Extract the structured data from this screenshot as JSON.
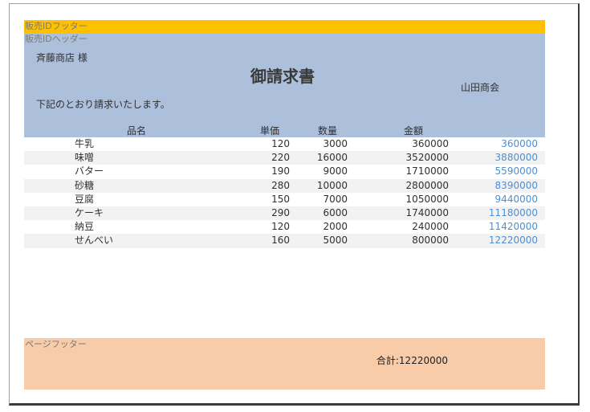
{
  "bands": {
    "footer_id_label": "販売IDフッター",
    "header_id_label": "販売IDヘッダー",
    "page_footer_label": "ページフッター"
  },
  "header": {
    "customer": "斉藤商店 様",
    "title": "御請求書",
    "company": "山田商会",
    "message": "下記のとおり請求いたします。"
  },
  "columns": {
    "name": "品名",
    "price": "単価",
    "quantity": "数量",
    "amount": "金額"
  },
  "rows": [
    {
      "name": "牛乳",
      "price": "120",
      "quantity": "3000",
      "amount": "360000",
      "running": "360000"
    },
    {
      "name": "味噌",
      "price": "220",
      "quantity": "16000",
      "amount": "3520000",
      "running": "3880000"
    },
    {
      "name": "バター",
      "price": "190",
      "quantity": "9000",
      "amount": "1710000",
      "running": "5590000"
    },
    {
      "name": "砂糖",
      "price": "280",
      "quantity": "10000",
      "amount": "2800000",
      "running": "8390000"
    },
    {
      "name": "豆腐",
      "price": "150",
      "quantity": "7000",
      "amount": "1050000",
      "running": "9440000"
    },
    {
      "name": "ケーキ",
      "price": "290",
      "quantity": "6000",
      "amount": "1740000",
      "running": "11180000"
    },
    {
      "name": "納豆",
      "price": "120",
      "quantity": "2000",
      "amount": "240000",
      "running": "11420000"
    },
    {
      "name": "せんべい",
      "price": "160",
      "quantity": "5000",
      "amount": "800000",
      "running": "12220000"
    }
  ],
  "footer": {
    "total": "合計:12220000"
  },
  "colors": {
    "footer_id_band": "#ffc000",
    "header_id_band": "#acbfdb",
    "page_footer_band": "#f8cba9",
    "running_total_text": "#4f8fd0",
    "alt_row": "#f2f2f2"
  }
}
